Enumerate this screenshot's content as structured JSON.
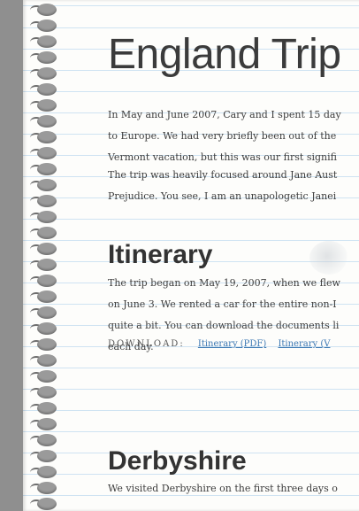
{
  "page": {
    "title": "England Trip",
    "intro_lines": [
      "In May and June 2007, Cary and I spent 15 day",
      "to Europe. We had very briefly been out of the",
      "Vermont vacation, but this was our first signifi"
    ],
    "focus_lines": [
      "The trip was heavily focused around Jane Aust",
      "Prejudice. You see, I am an unapologetic Janei"
    ],
    "itinerary": {
      "heading": "Itinerary",
      "lines": [
        "The trip began on May 19, 2007, when we flew",
        "on June 3. We rented a car for the entire non-I",
        "quite a bit. You can download the documents li",
        "each day."
      ]
    },
    "downloads": {
      "label": "DOWNLOAD:",
      "links": [
        "Itinerary (PDF)",
        "Itinerary (V"
      ]
    },
    "derbyshire": {
      "heading": "Derbyshire",
      "line": "We visited Derbyshire on the first three days o"
    }
  }
}
